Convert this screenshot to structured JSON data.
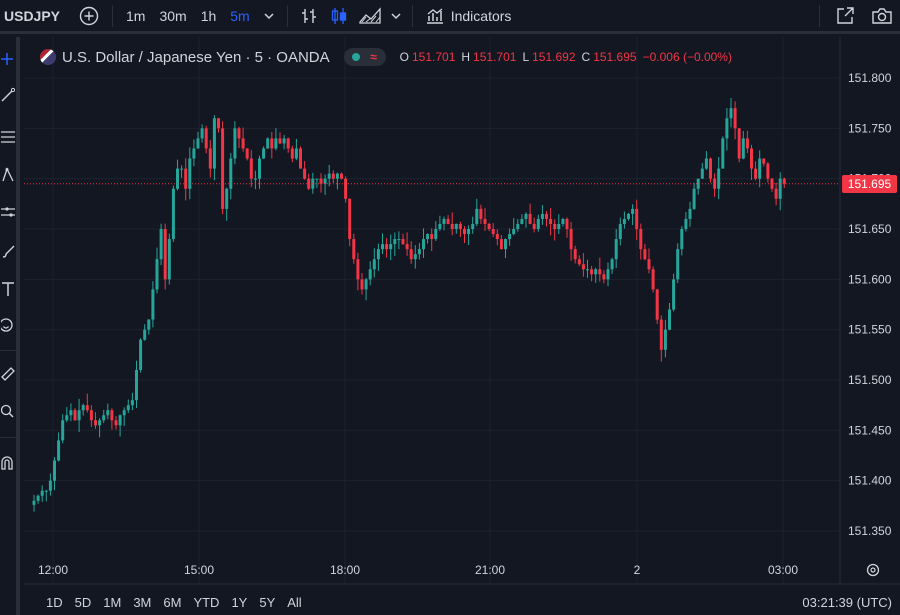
{
  "toolbar": {
    "symbol": "USDJPY",
    "timeframes": [
      "1m",
      "30m",
      "1h",
      "5m"
    ],
    "active_timeframe": "5m",
    "indicators_label": "Indicators"
  },
  "legend": {
    "title": "U.S. Dollar / Japanese Yen · 5 · OANDA",
    "open_label": "O",
    "open": "151.701",
    "high_label": "H",
    "high": "151.701",
    "low_label": "L",
    "low": "151.692",
    "close_label": "C",
    "close": "151.695",
    "change": "−0.006 (−0.00%)"
  },
  "price_axis": {
    "labels": [
      "151.800",
      "151.750",
      "151.700",
      "151.650",
      "151.600",
      "151.550",
      "151.500",
      "151.450",
      "151.400",
      "151.350"
    ],
    "current_price": "151.695"
  },
  "time_axis": {
    "labels": [
      "12:00",
      "15:00",
      "18:00",
      "21:00",
      "2",
      "03:00"
    ]
  },
  "ranges": [
    "1D",
    "5D",
    "1M",
    "3M",
    "6M",
    "YTD",
    "1Y",
    "5Y",
    "All"
  ],
  "clock": "03:21:39 (UTC)",
  "colors": {
    "up": "#26a69a",
    "down": "#f23645",
    "bg": "#131722",
    "grid": "#1e222d",
    "text": "#d1d4dc",
    "accent": "#2962ff"
  },
  "chart_data": {
    "type": "candlestick",
    "symbol": "USDJPY",
    "interval": "5",
    "ylim": [
      151.33,
      151.82
    ],
    "y_ticks": [
      151.35,
      151.4,
      151.45,
      151.5,
      151.55,
      151.6,
      151.65,
      151.7,
      151.75,
      151.8
    ],
    "x_ticks": [
      "12:00",
      "15:00",
      "18:00",
      "21:00",
      "2",
      "03:00"
    ],
    "last_price": 151.695,
    "close_path": [
      151.38,
      151.385,
      151.39,
      151.39,
      151.4,
      151.42,
      151.44,
      151.46,
      151.465,
      151.47,
      151.46,
      151.47,
      151.475,
      151.47,
      151.46,
      151.455,
      151.46,
      151.465,
      151.47,
      151.46,
      151.455,
      151.465,
      151.47,
      151.475,
      151.48,
      151.51,
      151.54,
      151.55,
      151.56,
      151.59,
      151.62,
      151.65,
      151.6,
      151.64,
      151.69,
      151.71,
      151.71,
      151.69,
      151.72,
      151.73,
      151.74,
      151.75,
      151.73,
      151.71,
      151.76,
      151.75,
      151.67,
      151.69,
      151.72,
      151.75,
      151.74,
      151.73,
      151.72,
      151.7,
      151.7,
      151.72,
      151.73,
      151.74,
      151.73,
      151.74,
      151.735,
      151.74,
      151.73,
      151.72,
      151.73,
      151.71,
      151.7,
      151.69,
      151.7,
      151.7,
      151.695,
      151.7,
      151.705,
      151.7,
      151.705,
      151.7,
      151.68,
      151.64,
      151.62,
      151.6,
      151.59,
      151.6,
      151.61,
      151.62,
      151.63,
      151.635,
      151.63,
      151.635,
      151.64,
      151.64,
      151.635,
      151.63,
      151.62,
      151.625,
      151.63,
      151.64,
      151.645,
      151.64,
      151.65,
      151.655,
      151.66,
      151.655,
      151.65,
      151.655,
      151.65,
      151.645,
      151.65,
      151.655,
      151.67,
      151.66,
      151.655,
      151.65,
      151.645,
      151.64,
      151.63,
      151.64,
      151.645,
      151.65,
      151.655,
      151.66,
      151.665,
      151.655,
      151.65,
      151.66,
      151.665,
      151.66,
      151.655,
      151.65,
      151.655,
      151.66,
      151.65,
      151.63,
      151.62,
      151.615,
      151.61,
      151.61,
      151.605,
      151.61,
      151.605,
      151.6,
      151.61,
      151.62,
      151.64,
      151.655,
      151.66,
      151.665,
      151.67,
      151.65,
      151.63,
      151.62,
      151.61,
      151.59,
      151.56,
      151.53,
      151.55,
      151.57,
      151.6,
      151.63,
      151.65,
      151.66,
      151.67,
      151.69,
      151.7,
      151.71,
      151.72,
      151.7,
      151.69,
      151.71,
      151.74,
      151.76,
      151.77,
      151.75,
      151.72,
      151.74,
      151.73,
      151.71,
      151.7,
      151.72,
      151.715,
      151.7,
      151.69,
      151.68,
      151.7,
      151.695
    ]
  }
}
